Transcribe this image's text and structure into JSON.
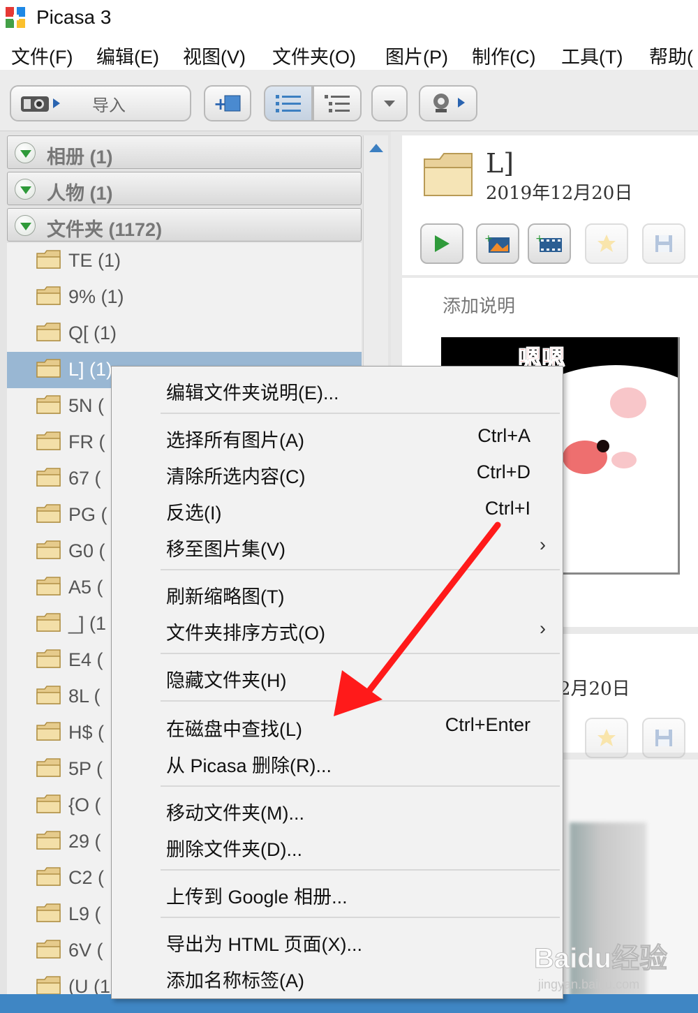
{
  "app": {
    "title": "Picasa 3"
  },
  "menubar": {
    "items": [
      "文件(F)",
      "编辑(E)",
      "视图(V)",
      "文件夹(O)",
      "图片(P)",
      "制作(C)",
      "工具(T)",
      "帮助("
    ]
  },
  "toolbar": {
    "import_label": "导入"
  },
  "tree": {
    "sections": [
      "相册 (1)",
      "人物 (1)",
      "文件夹 (1172)"
    ],
    "folders": [
      "TE (1)",
      "9% (1)",
      "Q[ (1)",
      "L] (1)",
      "5N (",
      "FR (",
      "67 (",
      "PG (",
      "G0 (",
      "A5 (",
      "_] (1",
      "E4 (",
      "8L (",
      "H$ (",
      "5P (",
      "{O (",
      "29 (",
      "C2 (",
      "L9 (",
      "6V (",
      "(U (1"
    ],
    "selected_index": 3
  },
  "preview": {
    "folder_title": "L]",
    "folder_date": "2019年12月20日",
    "caption_placeholder": "添加说明",
    "second_date": "2月20日"
  },
  "context_menu": {
    "items": [
      {
        "label": "编辑文件夹说明(E)...",
        "shortcut": "",
        "submenu": false
      },
      {
        "label": "选择所有图片(A)",
        "shortcut": "Ctrl+A",
        "submenu": false
      },
      {
        "label": "清除所选内容(C)",
        "shortcut": "Ctrl+D",
        "submenu": false
      },
      {
        "label": "反选(I)",
        "shortcut": "Ctrl+I",
        "submenu": false
      },
      {
        "label": "移至图片集(V)",
        "shortcut": "",
        "submenu": true
      },
      {
        "label": "刷新缩略图(T)",
        "shortcut": "",
        "submenu": false
      },
      {
        "label": "文件夹排序方式(O)",
        "shortcut": "",
        "submenu": true
      },
      {
        "label": "隐藏文件夹(H)",
        "shortcut": "",
        "submenu": false
      },
      {
        "label": "在磁盘中查找(L)",
        "shortcut": "Ctrl+Enter",
        "submenu": false
      },
      {
        "label": "从 Picasa 删除(R)...",
        "shortcut": "",
        "submenu": false
      },
      {
        "label": "移动文件夹(M)...",
        "shortcut": "",
        "submenu": false
      },
      {
        "label": "删除文件夹(D)...",
        "shortcut": "",
        "submenu": false
      },
      {
        "label": "上传到 Google 相册...",
        "shortcut": "",
        "submenu": false
      },
      {
        "label": "导出为 HTML 页面(X)...",
        "shortcut": "",
        "submenu": false
      },
      {
        "label": "添加名称标签(A)",
        "shortcut": "",
        "submenu": false
      }
    ],
    "submenu_glyph": "›"
  },
  "thumbnail": {
    "sticker_text": "嗯嗯"
  },
  "watermark": {
    "main": "Baidu经验",
    "sub": "jingyan.baidu.com"
  },
  "colors": {
    "selection": "#99b7d3",
    "annotation_arrow": "#ff1a1a",
    "status_strip": "#3f86c4",
    "play_green": "#2f9a3a"
  }
}
